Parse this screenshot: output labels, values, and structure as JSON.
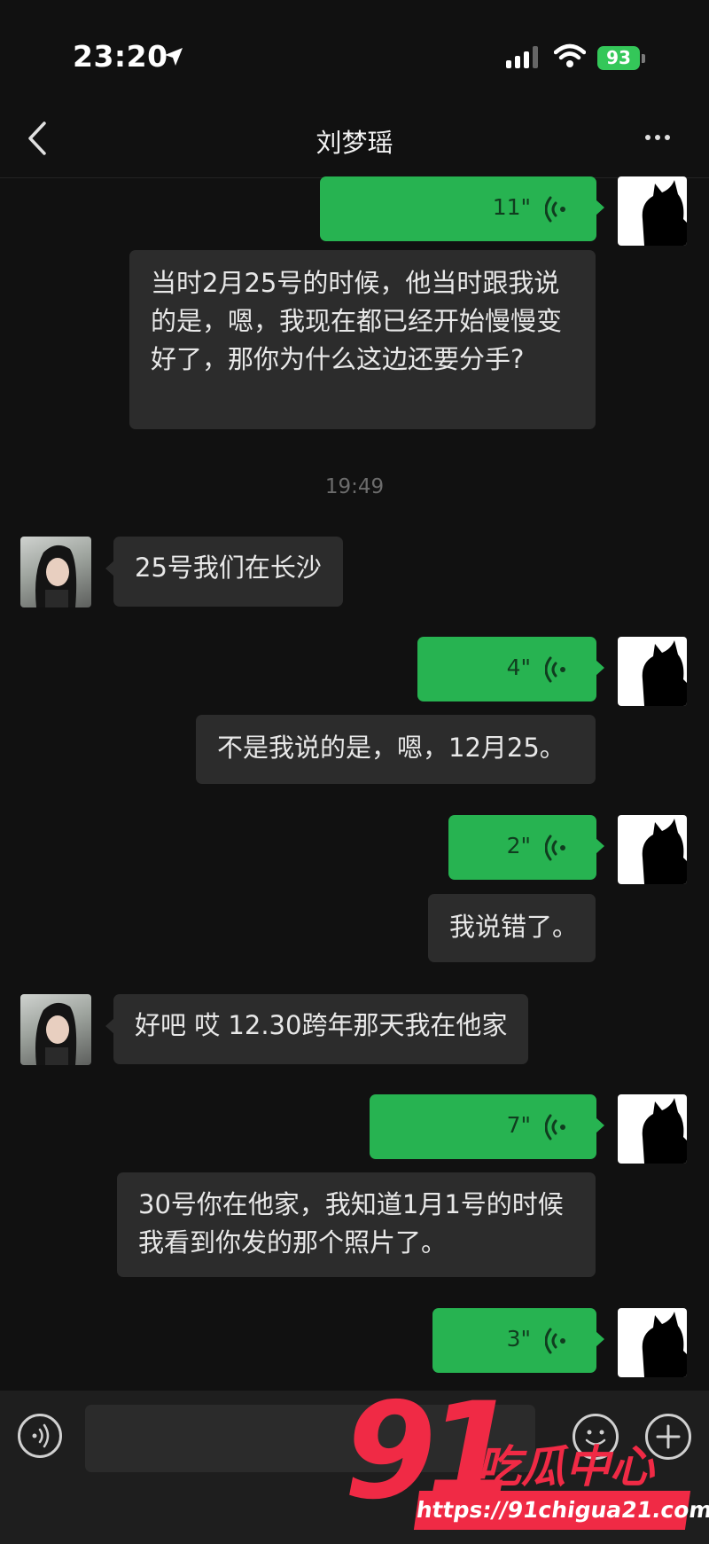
{
  "status_bar": {
    "time": "23:20",
    "battery": "93"
  },
  "header": {
    "title": "刘梦瑶"
  },
  "messages": [
    {
      "type": "voice",
      "duration": "11\""
    },
    {
      "type": "transcript",
      "text": "当时2月25号的时候，他当时跟我说的是，嗯，我现在都已经开始慢慢变好了，那你为什么这边还要分手?"
    },
    {
      "type": "timestamp",
      "text": "19:49"
    },
    {
      "type": "incoming",
      "text": "25号我们在长沙"
    },
    {
      "type": "voice",
      "duration": "4\""
    },
    {
      "type": "transcript",
      "text": "不是我说的是，嗯，12月25。"
    },
    {
      "type": "voice",
      "duration": "2\""
    },
    {
      "type": "transcript",
      "text": "我说错了。"
    },
    {
      "type": "incoming",
      "text": "好吧 哎 12.30跨年那天我在他家"
    },
    {
      "type": "voice",
      "duration": "7\""
    },
    {
      "type": "transcript",
      "text": "30号你在他家，我知道1月1号的时候我看到你发的那个照片了。"
    },
    {
      "type": "voice",
      "duration": "3\""
    }
  ],
  "input_bar": {
    "placeholder": ""
  },
  "watermark": {
    "number": "91",
    "brand": "吃瓜中心",
    "url": "https://91chigua21.com"
  },
  "colors": {
    "background": "#111111",
    "voice_bubble": "#27b351",
    "text_bubble": "#2c2c2c",
    "watermark": "#f02a45"
  },
  "icons": [
    "location-arrow-icon",
    "cellular-signal-icon",
    "wifi-icon",
    "battery-icon",
    "back-chevron-icon",
    "more-dots-icon",
    "voice-wave-icon",
    "voice-mode-icon",
    "emoji-icon",
    "plus-icon"
  ]
}
